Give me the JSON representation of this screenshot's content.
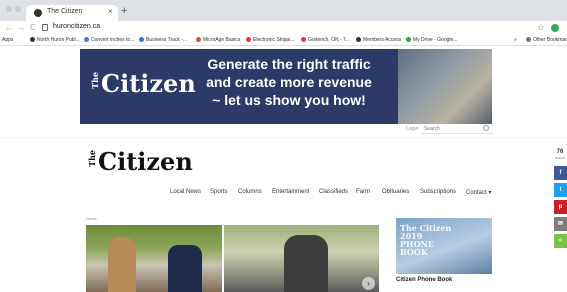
{
  "browser": {
    "tab_title": "The Citizen",
    "tab_close": "×",
    "new_tab": "+",
    "url": "huroncitizen.ca",
    "back": "←",
    "forward": "→",
    "reload": "C",
    "star": "☆",
    "bookmarks": [
      {
        "label": "Apps",
        "color": ""
      },
      {
        "label": "North Huron Publ...",
        "color": "#333333"
      },
      {
        "label": "Convert Inches to...",
        "color": "#4a7bd0"
      },
      {
        "label": "Business Track -...",
        "color": "#3b6fd6"
      },
      {
        "label": "MicroAge Basics",
        "color": "#d94f3a"
      },
      {
        "label": "Electronic Shippi...",
        "color": "#e23b2e"
      },
      {
        "label": "Goderich, ON - 7...",
        "color": "#d33c3c"
      },
      {
        "label": "Members Access",
        "color": "#333333"
      },
      {
        "label": "My Drive - Google...",
        "color": "#2f9e4a"
      },
      {
        "label": "»",
        "color": ""
      },
      {
        "label": "Other Bookmarks",
        "color": "#777777"
      }
    ]
  },
  "ad": {
    "logo_the": "The",
    "logo": "Citizen",
    "line1": "Generate the right traffic",
    "line2": "and create more revenue",
    "line3": "~ let us show you how!"
  },
  "header": {
    "login": "Login",
    "search_placeholder": "Search"
  },
  "site": {
    "logo_the": "The",
    "logo": "Citizen",
    "nav": [
      "Local News",
      "Sports",
      "Columns",
      "Entertainment",
      "Classifieds",
      "Farm",
      "Obituaries",
      "Subscriptions",
      "Contact ▾"
    ]
  },
  "content": {
    "breadcrumb": "Home",
    "slider_next": "›",
    "phonebook_cover": "The Citizen\n2019\nPHONE\nBOOK",
    "phonebook_caption": "Citizen Phone Book"
  },
  "share": {
    "count": "76",
    "label": "Shares",
    "buttons": [
      {
        "name": "facebook",
        "glyph": "f",
        "color": "#3b5998"
      },
      {
        "name": "twitter",
        "glyph": "t",
        "color": "#1da1f2"
      },
      {
        "name": "pinterest",
        "glyph": "p",
        "color": "#cb2027"
      },
      {
        "name": "email",
        "glyph": "✉",
        "color": "#7d7d7d"
      },
      {
        "name": "share",
        "glyph": "<",
        "color": "#7bc144"
      }
    ]
  }
}
